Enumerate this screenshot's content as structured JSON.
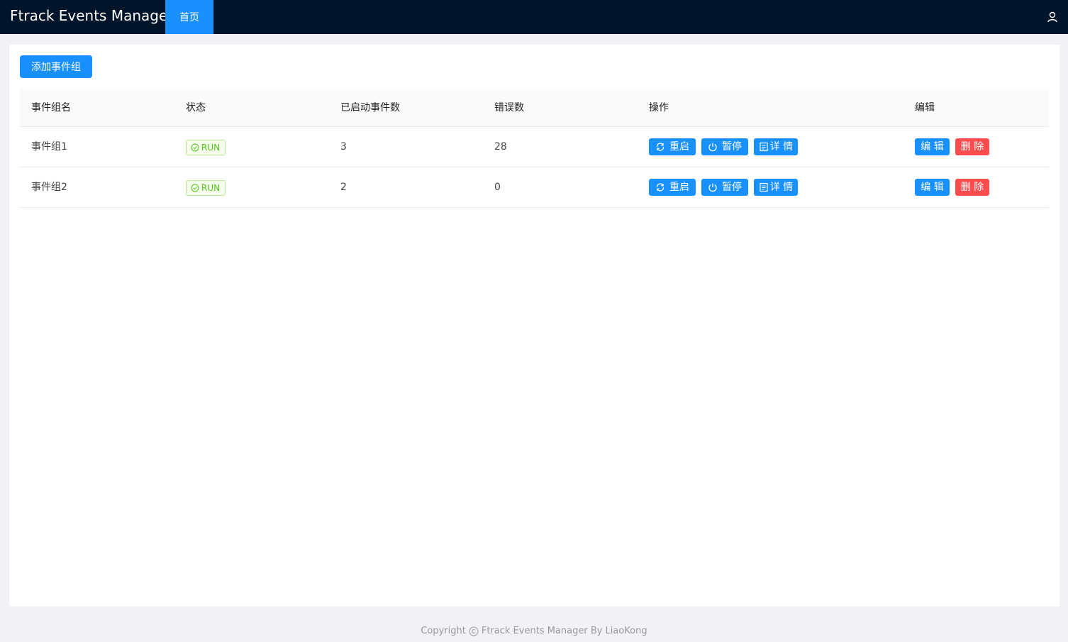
{
  "header": {
    "app_title": "Ftrack Events Manager",
    "nav_home": "首页",
    "user_icon": "user-icon"
  },
  "toolbar": {
    "add_group_label": "添加事件组"
  },
  "table": {
    "columns": [
      "事件组名",
      "状态",
      "已启动事件数",
      "错误数",
      "操作",
      "编辑"
    ],
    "rows": [
      {
        "name": "事件组1",
        "status": "RUN",
        "started": "3",
        "errors": "28",
        "restart": "重启",
        "pause": "暂停",
        "details": "详 情",
        "edit": "编 辑",
        "delete": "删 除"
      },
      {
        "name": "事件组2",
        "status": "RUN",
        "started": "2",
        "errors": "0",
        "restart": "重启",
        "pause": "暂停",
        "details": "详 情",
        "edit": "编 辑",
        "delete": "删 除"
      }
    ]
  },
  "footer": {
    "copyright_prefix": "Copyright",
    "copyright_rest": "Ftrack Events Manager By LiaoKong"
  },
  "colors": {
    "header_bg": "#001529",
    "primary": "#1890ff",
    "danger": "#ff4d4f",
    "success": "#52c41a"
  }
}
